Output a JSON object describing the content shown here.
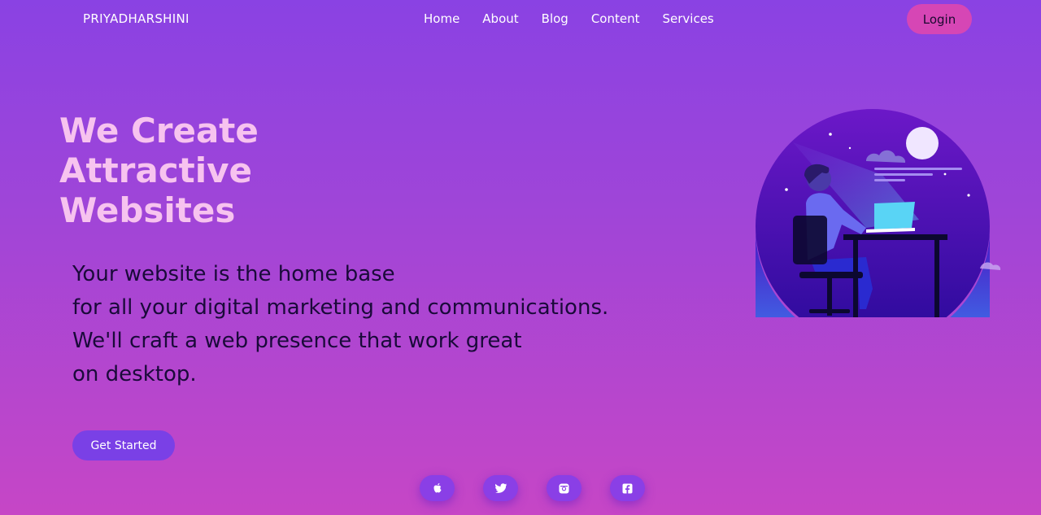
{
  "navbar": {
    "brand": "PRIYADHARSHINI",
    "links": [
      "Home",
      "About",
      "Blog",
      "Content",
      "Services"
    ],
    "login_label": "Login"
  },
  "hero": {
    "headline_lines": [
      "We Create",
      "Attractive",
      "Websites"
    ],
    "description_lines": [
      "Your website is the home base",
      "for all your digital marketing and communications.",
      "We'll craft a web presence that work great",
      "on desktop."
    ],
    "cta_label": "Get Started"
  },
  "socials": [
    {
      "icon": "apple-icon"
    },
    {
      "icon": "twitter-icon"
    },
    {
      "icon": "instagram-icon"
    },
    {
      "icon": "facebook-icon"
    }
  ],
  "colors": {
    "background_top": "#8a42e3",
    "background_bottom": "#c646c6",
    "headline": "#f7c3ef",
    "description": "#1a0a3a",
    "login_button": "#d646b5",
    "cta_button": "#7a40e6"
  }
}
